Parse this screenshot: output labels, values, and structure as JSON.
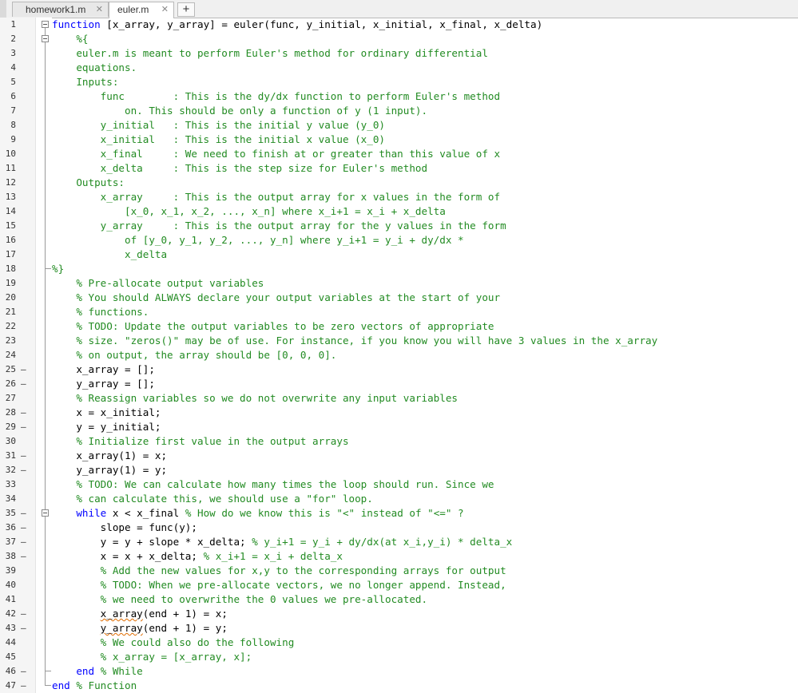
{
  "tabs": [
    {
      "label": "homework1.m",
      "close": "✕",
      "active": false
    },
    {
      "label": "euler.m",
      "close": "✕",
      "active": true
    }
  ],
  "add_tab": "+",
  "gutter_marker": "–",
  "editor": {
    "lines": [
      {
        "n": "1",
        "fold": "box",
        "parts": [
          {
            "t": "function",
            "c": "kw"
          },
          {
            "t": " [x_array, y_array] = euler(func, y_initial, x_initial, x_final, x_delta)"
          }
        ]
      },
      {
        "n": "2",
        "fold": "box",
        "parts": [
          {
            "t": "    %{",
            "c": "cm"
          }
        ]
      },
      {
        "n": "3",
        "parts": [
          {
            "t": "    euler.m is meant to perform Euler's method for ordinary differential",
            "c": "cm"
          }
        ]
      },
      {
        "n": "4",
        "parts": [
          {
            "t": "    equations.",
            "c": "cm"
          }
        ]
      },
      {
        "n": "5",
        "parts": [
          {
            "t": "    Inputs:",
            "c": "cm"
          }
        ]
      },
      {
        "n": "6",
        "parts": [
          {
            "t": "        func        : This is the dy/dx function to perform Euler's method",
            "c": "cm"
          }
        ]
      },
      {
        "n": "7",
        "parts": [
          {
            "t": "            on. This should be only a function of y (1 input).",
            "c": "cm"
          }
        ]
      },
      {
        "n": "8",
        "parts": [
          {
            "t": "        y_initial   : This is the initial y value (y_0)",
            "c": "cm"
          }
        ]
      },
      {
        "n": "9",
        "parts": [
          {
            "t": "        x_initial   : This is the initial x value (x_0)",
            "c": "cm"
          }
        ]
      },
      {
        "n": "10",
        "parts": [
          {
            "t": "        x_final     : We need to finish at or greater than this value of x",
            "c": "cm"
          }
        ]
      },
      {
        "n": "11",
        "parts": [
          {
            "t": "        x_delta     : This is the step size for Euler's method",
            "c": "cm"
          }
        ]
      },
      {
        "n": "12",
        "parts": [
          {
            "t": "    Outputs:",
            "c": "cm"
          }
        ]
      },
      {
        "n": "13",
        "parts": [
          {
            "t": "        x_array     : This is the output array for x values in the form of",
            "c": "cm"
          }
        ]
      },
      {
        "n": "14",
        "parts": [
          {
            "t": "            [x_0, x_1, x_2, ..., x_n] where x_i+1 = x_i + x_delta",
            "c": "cm"
          }
        ]
      },
      {
        "n": "15",
        "parts": [
          {
            "t": "        y_array     : This is the output array for the y values in the form",
            "c": "cm"
          }
        ]
      },
      {
        "n": "16",
        "parts": [
          {
            "t": "            of [y_0, y_1, y_2, ..., y_n] where y_i+1 = y_i + dy/dx *",
            "c": "cm"
          }
        ]
      },
      {
        "n": "17",
        "parts": [
          {
            "t": "            x_delta",
            "c": "cm"
          }
        ]
      },
      {
        "n": "18",
        "fold": "end",
        "parts": [
          {
            "t": "%}",
            "c": "cm"
          }
        ]
      },
      {
        "n": "19",
        "parts": [
          {
            "t": "    % Pre-allocate output variables",
            "c": "cm"
          }
        ]
      },
      {
        "n": "20",
        "parts": [
          {
            "t": "    % You should ALWAYS declare your output variables at the start of your",
            "c": "cm"
          }
        ]
      },
      {
        "n": "21",
        "parts": [
          {
            "t": "    % functions.",
            "c": "cm"
          }
        ]
      },
      {
        "n": "22",
        "parts": [
          {
            "t": "    % TODO: Update the output variables to be zero vectors of appropriate",
            "c": "cm"
          }
        ]
      },
      {
        "n": "23",
        "parts": [
          {
            "t": "    % size. \"zeros()\" may be of use. For instance, if you know you will have 3 values in the x_array",
            "c": "cm"
          }
        ]
      },
      {
        "n": "24",
        "parts": [
          {
            "t": "    % on output, the array should be [0, 0, 0].",
            "c": "cm"
          }
        ]
      },
      {
        "n": "25",
        "dash": true,
        "parts": [
          {
            "t": "    x_array = [];"
          }
        ]
      },
      {
        "n": "26",
        "dash": true,
        "parts": [
          {
            "t": "    y_array = [];"
          }
        ]
      },
      {
        "n": "27",
        "parts": [
          {
            "t": "    % Reassign variables so we do not overwrite any input variables",
            "c": "cm"
          }
        ]
      },
      {
        "n": "28",
        "dash": true,
        "parts": [
          {
            "t": "    x = x_initial;"
          }
        ]
      },
      {
        "n": "29",
        "dash": true,
        "parts": [
          {
            "t": "    y = y_initial;"
          }
        ]
      },
      {
        "n": "30",
        "parts": [
          {
            "t": "    % Initialize first value in the output arrays",
            "c": "cm"
          }
        ]
      },
      {
        "n": "31",
        "dash": true,
        "parts": [
          {
            "t": "    x_array(1) = x;"
          }
        ]
      },
      {
        "n": "32",
        "dash": true,
        "parts": [
          {
            "t": "    y_array(1) = y;"
          }
        ]
      },
      {
        "n": "33",
        "parts": [
          {
            "t": "    % TODO: We can calculate how many times the loop should run. Since we",
            "c": "cm"
          }
        ]
      },
      {
        "n": "34",
        "parts": [
          {
            "t": "    % can calculate this, we should use a \"for\" loop.",
            "c": "cm"
          }
        ]
      },
      {
        "n": "35",
        "dash": true,
        "fold": "box",
        "parts": [
          {
            "t": "    "
          },
          {
            "t": "while",
            "c": "kw"
          },
          {
            "t": " x < x_final "
          },
          {
            "t": "% How do we know this is \"<\" instead of \"<=\" ?",
            "c": "cm"
          }
        ]
      },
      {
        "n": "36",
        "dash": true,
        "parts": [
          {
            "t": "        slope = func(y);"
          }
        ]
      },
      {
        "n": "37",
        "dash": true,
        "parts": [
          {
            "t": "        y = y + slope * x_delta; "
          },
          {
            "t": "% y_i+1 = y_i + dy/dx(at x_i,y_i) * delta_x",
            "c": "cm"
          }
        ]
      },
      {
        "n": "38",
        "dash": true,
        "parts": [
          {
            "t": "        x = x + x_delta; "
          },
          {
            "t": "% x_i+1 = x_i + delta_x",
            "c": "cm"
          }
        ]
      },
      {
        "n": "39",
        "parts": [
          {
            "t": "        % Add the new values for x,y to the corresponding arrays for output",
            "c": "cm"
          }
        ]
      },
      {
        "n": "40",
        "parts": [
          {
            "t": "        % TODO: When we pre-allocate vectors, we no longer append. Instead,",
            "c": "cm"
          }
        ]
      },
      {
        "n": "41",
        "parts": [
          {
            "t": "        % we need to overwrithe the 0 values we pre-allocated.",
            "c": "cm"
          }
        ]
      },
      {
        "n": "42",
        "dash": true,
        "parts": [
          {
            "t": "        "
          },
          {
            "t": "x_array",
            "c": "sq"
          },
          {
            "t": "(end + 1) = x;"
          }
        ]
      },
      {
        "n": "43",
        "dash": true,
        "parts": [
          {
            "t": "        "
          },
          {
            "t": "y_array",
            "c": "sq"
          },
          {
            "t": "(end + 1) = y;"
          }
        ]
      },
      {
        "n": "44",
        "parts": [
          {
            "t": "        % We could also do the following",
            "c": "cm"
          }
        ]
      },
      {
        "n": "45",
        "parts": [
          {
            "t": "        % x_array = [x_array, x];",
            "c": "cm"
          }
        ]
      },
      {
        "n": "46",
        "dash": true,
        "fold": "end",
        "parts": [
          {
            "t": "    "
          },
          {
            "t": "end",
            "c": "kw"
          },
          {
            "t": " "
          },
          {
            "t": "% While",
            "c": "cm"
          }
        ]
      },
      {
        "n": "47",
        "dash": true,
        "fold": "end",
        "parts": [
          {
            "t": "end",
            "c": "kw"
          },
          {
            "t": " "
          },
          {
            "t": "% Function",
            "c": "cm"
          }
        ]
      }
    ]
  }
}
